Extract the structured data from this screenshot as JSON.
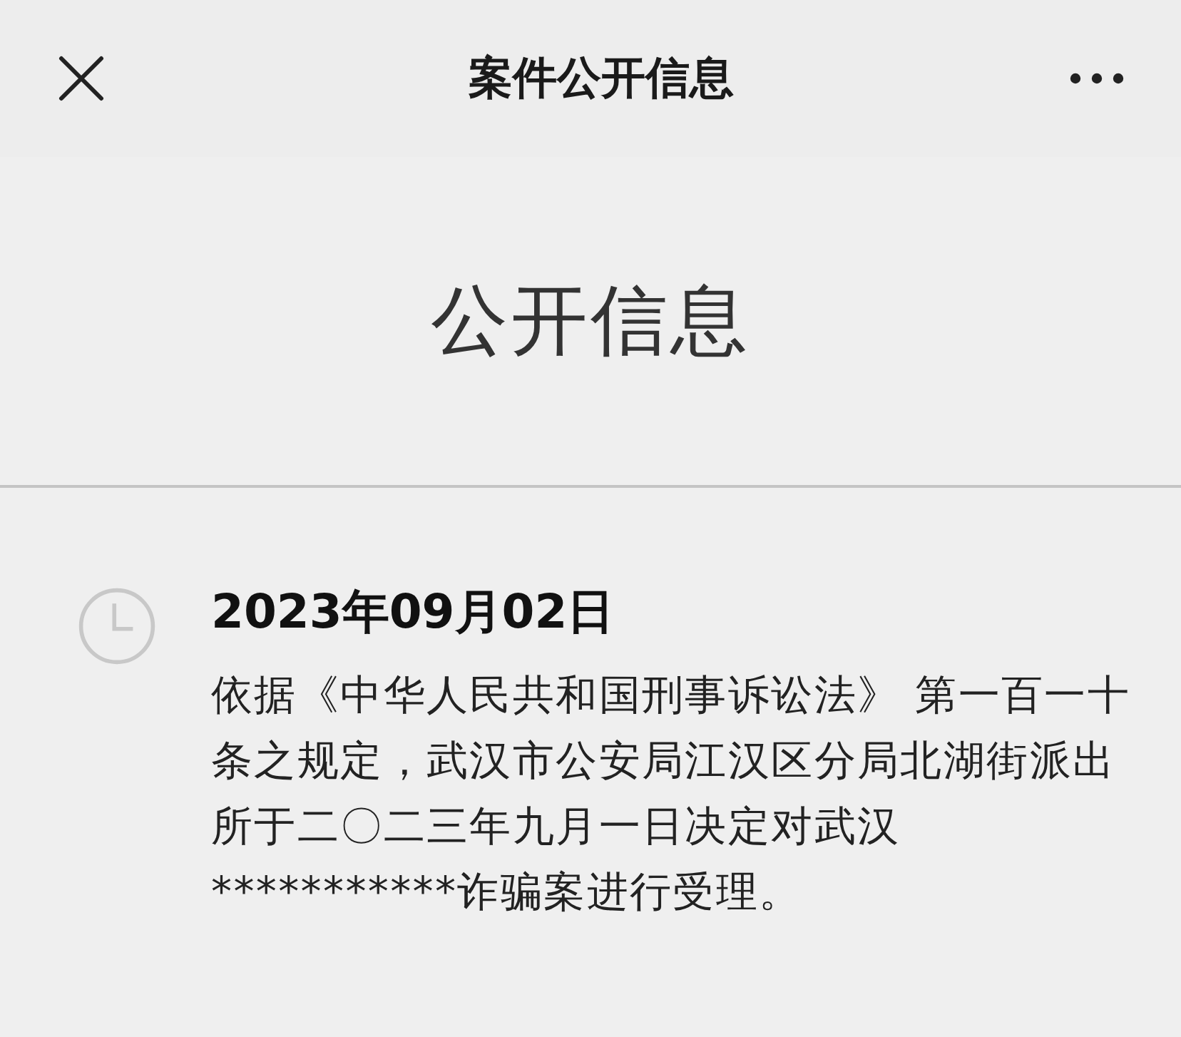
{
  "header": {
    "title": "案件公开信息"
  },
  "heading": "公开信息",
  "entries": [
    {
      "date": "2023年09月02日",
      "text": "依据《中华人民共和国刑事诉讼法》 第一百一十条之规定，武汉市公安局江汉区分局北湖街派出所于二〇二三年九月一日决定对武汉***********诈骗案进行受理。"
    }
  ]
}
